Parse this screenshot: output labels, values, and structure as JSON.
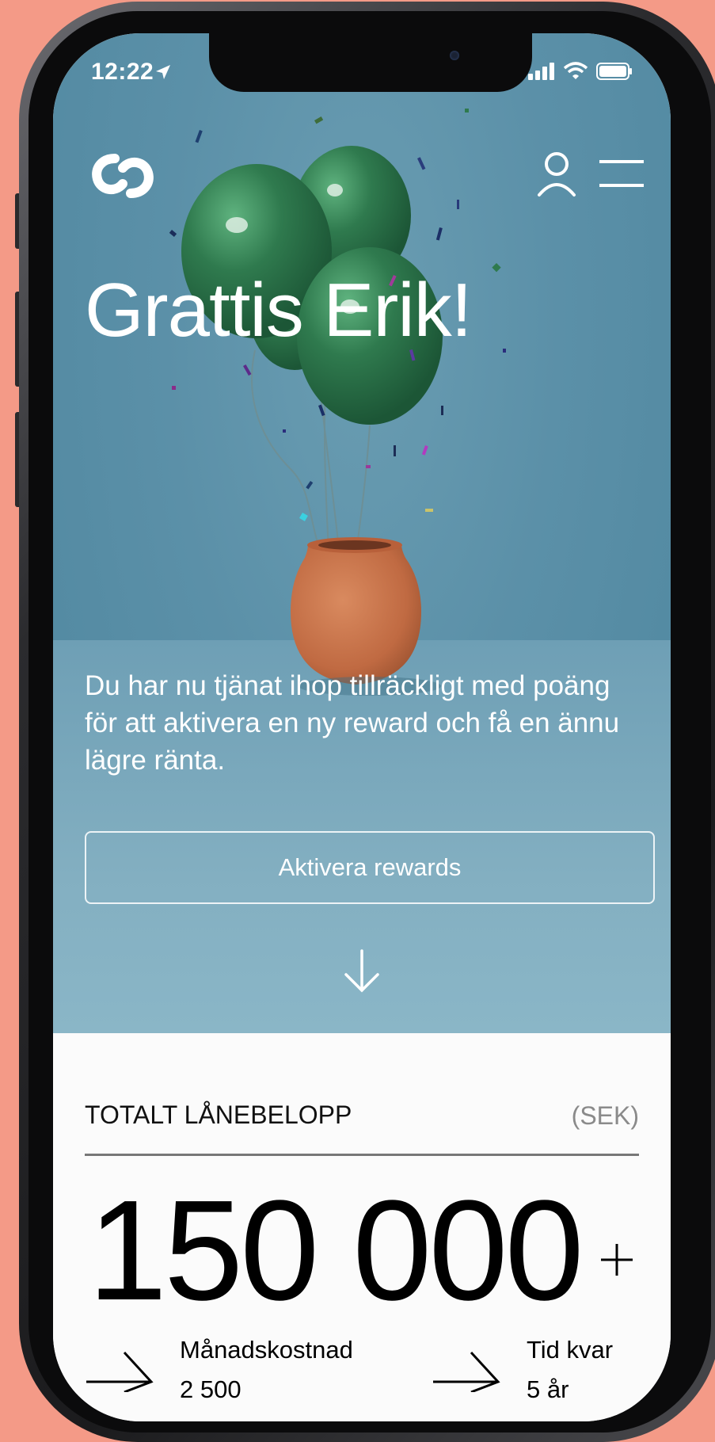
{
  "status_bar": {
    "time": "12:22"
  },
  "header": {
    "logo_icon": "link-logo-icon",
    "user_icon": "user-icon",
    "menu_icon": "hamburger-menu-icon"
  },
  "hero": {
    "title": "Grattis Erik!",
    "description": "Du har nu tjänat ihop tillräckligt med poäng för att aktivera en ny reward och få en ännu lägre ränta.",
    "cta_label": "Aktivera rewards",
    "scroll_icon": "arrow-down-icon"
  },
  "loan": {
    "label": "TOTALT LÅNEBELOPP",
    "currency": "(SEK)",
    "amount": "150 000",
    "plus_label": "+"
  },
  "stats": [
    {
      "label": "Månadskostnad",
      "value": "2 500"
    },
    {
      "label": "Tid kvar",
      "value": "5 år"
    }
  ],
  "colors": {
    "background": "#f49a87",
    "hero": "#5b90a8",
    "balloon": "#2f7a4e",
    "vase": "#c8734a",
    "text_light": "#ffffff"
  }
}
